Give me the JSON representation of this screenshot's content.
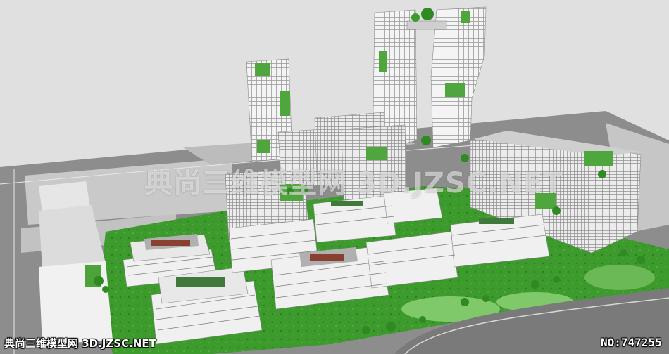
{
  "image": {
    "subject": "3D model render of an urban mixed-use development with stepped terraced buildings, towers and green roofs"
  },
  "watermarks": {
    "center": "典尚三维模型网 3D.JZSC.NET",
    "bottom_left": "典尚三维模型网 3D.JZSC.NET",
    "bottom_right": "NO:747255"
  },
  "colors": {
    "sky": "#e0e0e0",
    "road": "#8a8a8a",
    "block": "#cfcfcf",
    "grass": "#3a8f2a",
    "facade": "#f2f2f2",
    "roof": "#bdbdbd"
  }
}
